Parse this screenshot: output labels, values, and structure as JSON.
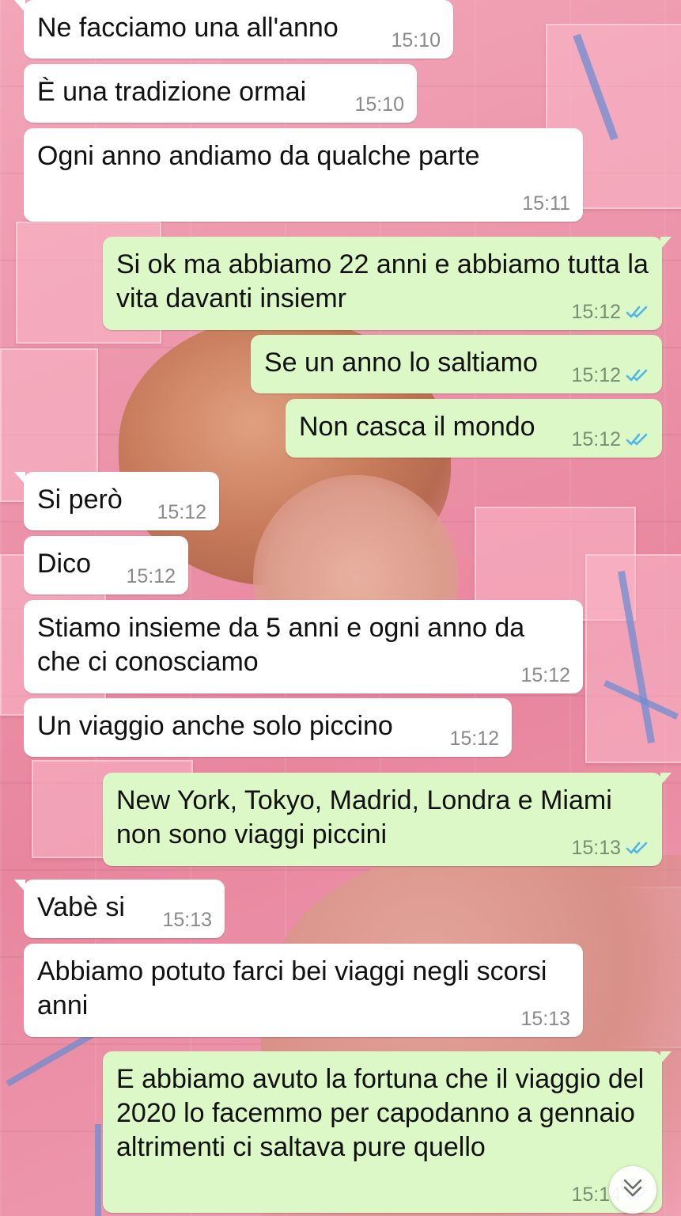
{
  "messages": [
    {
      "side": "in",
      "text": "Ne facciamo una all'anno",
      "time": "15:10"
    },
    {
      "side": "in",
      "text": "È una tradizione ormai",
      "time": "15:10"
    },
    {
      "side": "in",
      "text": "Ogni anno andiamo da qualche parte",
      "time": "15:11"
    },
    {
      "side": "out",
      "text": "Si ok ma abbiamo 22 anni e abbiamo tutta la vita davanti insiemr",
      "time": "15:12",
      "status": "read"
    },
    {
      "side": "out",
      "text": "Se un anno lo saltiamo",
      "time": "15:12",
      "status": "read"
    },
    {
      "side": "out",
      "text": "Non casca il mondo",
      "time": "15:12",
      "status": "read"
    },
    {
      "side": "in",
      "text": "Si però",
      "time": "15:12"
    },
    {
      "side": "in",
      "text": "Dico",
      "time": "15:12"
    },
    {
      "side": "in",
      "text": "Stiamo insieme da 5 anni e ogni anno da che ci conosciamo",
      "time": "15:12"
    },
    {
      "side": "in",
      "text": "Un viaggio anche solo piccino",
      "time": "15:12"
    },
    {
      "side": "out",
      "text": "New York, Tokyo, Madrid, Londra e Miami non sono viaggi piccini",
      "time": "15:13",
      "status": "read"
    },
    {
      "side": "in",
      "text": "Vabè si",
      "time": "15:13"
    },
    {
      "side": "in",
      "text": "Abbiamo potuto farci bei viaggi negli scorsi anni",
      "time": "15:13"
    },
    {
      "side": "out",
      "text": "E abbiamo avuto la fortuna che il viaggio del 2020 lo facemmo per capodanno a gennaio altrimenti ci saltava pure quello",
      "time": "15:14",
      "status": "read"
    }
  ],
  "colors": {
    "incoming_bubble": "#ffffff",
    "outgoing_bubble": "#dcf8c6",
    "read_ticks": "#4fb6ec",
    "timestamp": "#8a8a8a"
  },
  "icons": {
    "read_receipt": "double-check-icon",
    "scroll_down": "double-chevron-down-icon"
  }
}
